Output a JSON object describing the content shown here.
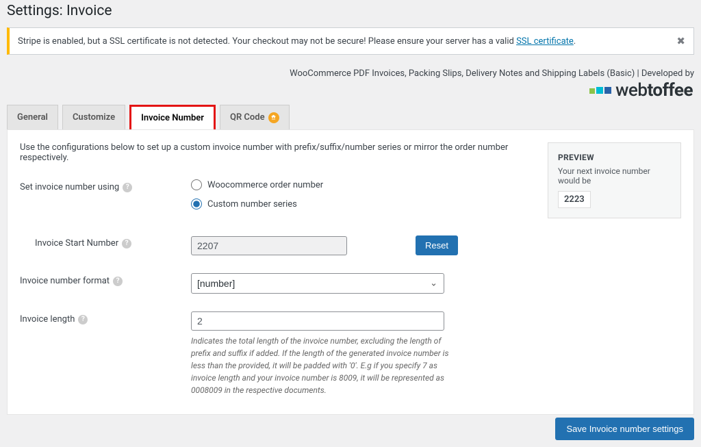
{
  "header": {
    "title": "Settings: Invoice"
  },
  "notice": {
    "text_pre": "Stripe is enabled, but a SSL certificate is not detected. Your checkout may not be secure! Please ensure your server has a valid ",
    "link_text": "SSL certificate",
    "text_post": "."
  },
  "meta": {
    "dev_line": "WooCommerce PDF Invoices, Packing Slips, Delivery Notes and Shipping Labels (Basic) | Developed by",
    "brand_prefix": "web",
    "brand_bold": "toffee"
  },
  "tabs": {
    "general": "General",
    "customize": "Customize",
    "invoice_number": "Invoice Number",
    "qr": "QR Code"
  },
  "intro": "Use the configurations below to set up a custom invoice number with prefix/suffix/number series or mirror the order number respectively.",
  "fields": {
    "set_using": {
      "label": "Set invoice number using",
      "opt1": "Woocommerce order number",
      "opt2": "Custom number series"
    },
    "start": {
      "label": "Invoice Start Number",
      "value": "2207",
      "reset": "Reset"
    },
    "format": {
      "label": "Invoice number format",
      "value": "[number]"
    },
    "length": {
      "label": "Invoice length",
      "value": "2",
      "desc": "Indicates the total length of the invoice number, excluding the length of prefix and suffix if added. If the length of the generated invoice number is less than the provided, it will be padded with '0'. E.g if you specify 7 as invoice length and your invoice number is 8009, it will be represented as 0008009 in the respective documents."
    }
  },
  "preview": {
    "heading": "PREVIEW",
    "text": "Your next invoice number would be",
    "value": "2223"
  },
  "actions": {
    "save": "Save Invoice number settings"
  }
}
